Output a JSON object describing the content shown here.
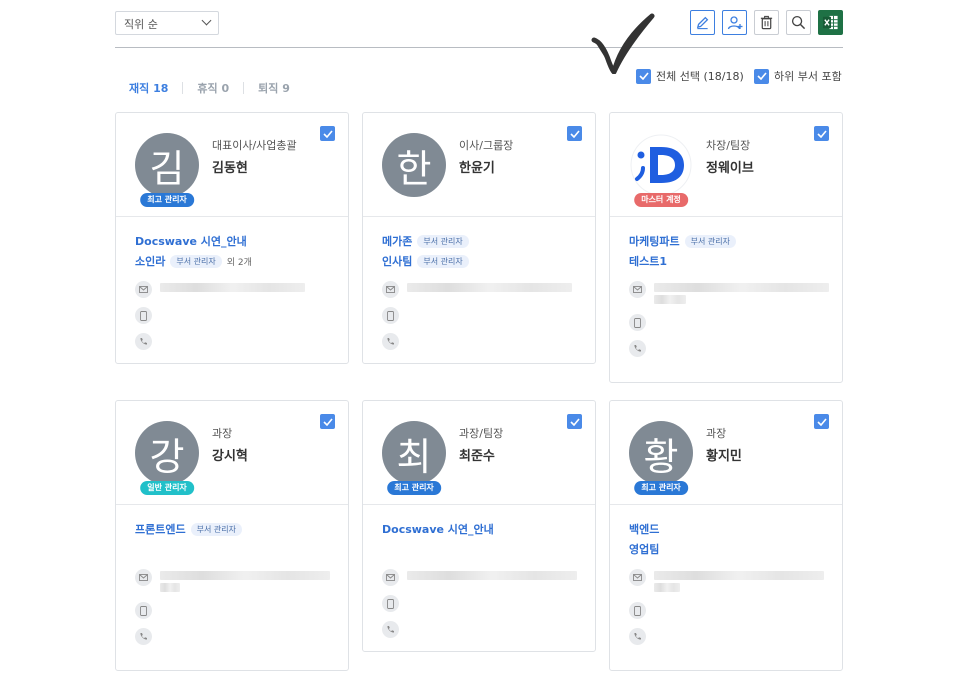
{
  "toolbar": {
    "sort_value": "직위 순",
    "buttons": [
      "edit-icon",
      "add-user-icon",
      "trash-icon",
      "search-icon",
      "excel-icon"
    ]
  },
  "tabs": [
    {
      "label": "재직 18"
    },
    {
      "label": "휴직 0"
    },
    {
      "label": "퇴직 9"
    }
  ],
  "options": {
    "select_all": "전체 선택 (18/18)",
    "include_sub": "하위 부서 포함"
  },
  "colors": {
    "accent": "#3d7fe0",
    "avatar": "#808a94",
    "excel": "#1e7145"
  },
  "cards": [
    {
      "avatar": "김",
      "badge": "최고 관리자",
      "position": "대표이사/사업총괄",
      "name": "김동현",
      "depts": [
        {
          "name": "Docswave 시연_안내",
          "badge": ""
        },
        {
          "name": "소인라",
          "badge": "부서 관리자",
          "extra": "외 2개"
        }
      ]
    },
    {
      "avatar": "한",
      "badge": "",
      "position": "이사/그룹장",
      "name": "한윤기",
      "depts": [
        {
          "name": "메가존",
          "badge": "부서 관리자"
        },
        {
          "name": "인사팀",
          "badge": "부서 관리자"
        }
      ]
    },
    {
      "avatar": "",
      "badge": "마스터 계정",
      "position": "차장/팀장",
      "name": "정웨이브",
      "depts": [
        {
          "name": "마케팅파트",
          "badge": "부서 관리자"
        },
        {
          "name": "테스트1",
          "badge": ""
        }
      ]
    },
    {
      "avatar": "강",
      "badge": "일반 관리자",
      "position": "과장",
      "name": "강시혁",
      "depts": [
        {
          "name": "프론트엔드",
          "badge": "부서 관리자"
        }
      ]
    },
    {
      "avatar": "최",
      "badge": "최고 관리자",
      "position": "과장/팀장",
      "name": "최준수",
      "depts": [
        {
          "name": "Docswave 시연_안내",
          "badge": ""
        }
      ]
    },
    {
      "avatar": "황",
      "badge": "최고 관리자",
      "position": "과장",
      "name": "황지민",
      "depts": [
        {
          "name": "백엔드",
          "badge": ""
        },
        {
          "name": "영업팀",
          "badge": ""
        }
      ]
    }
  ]
}
